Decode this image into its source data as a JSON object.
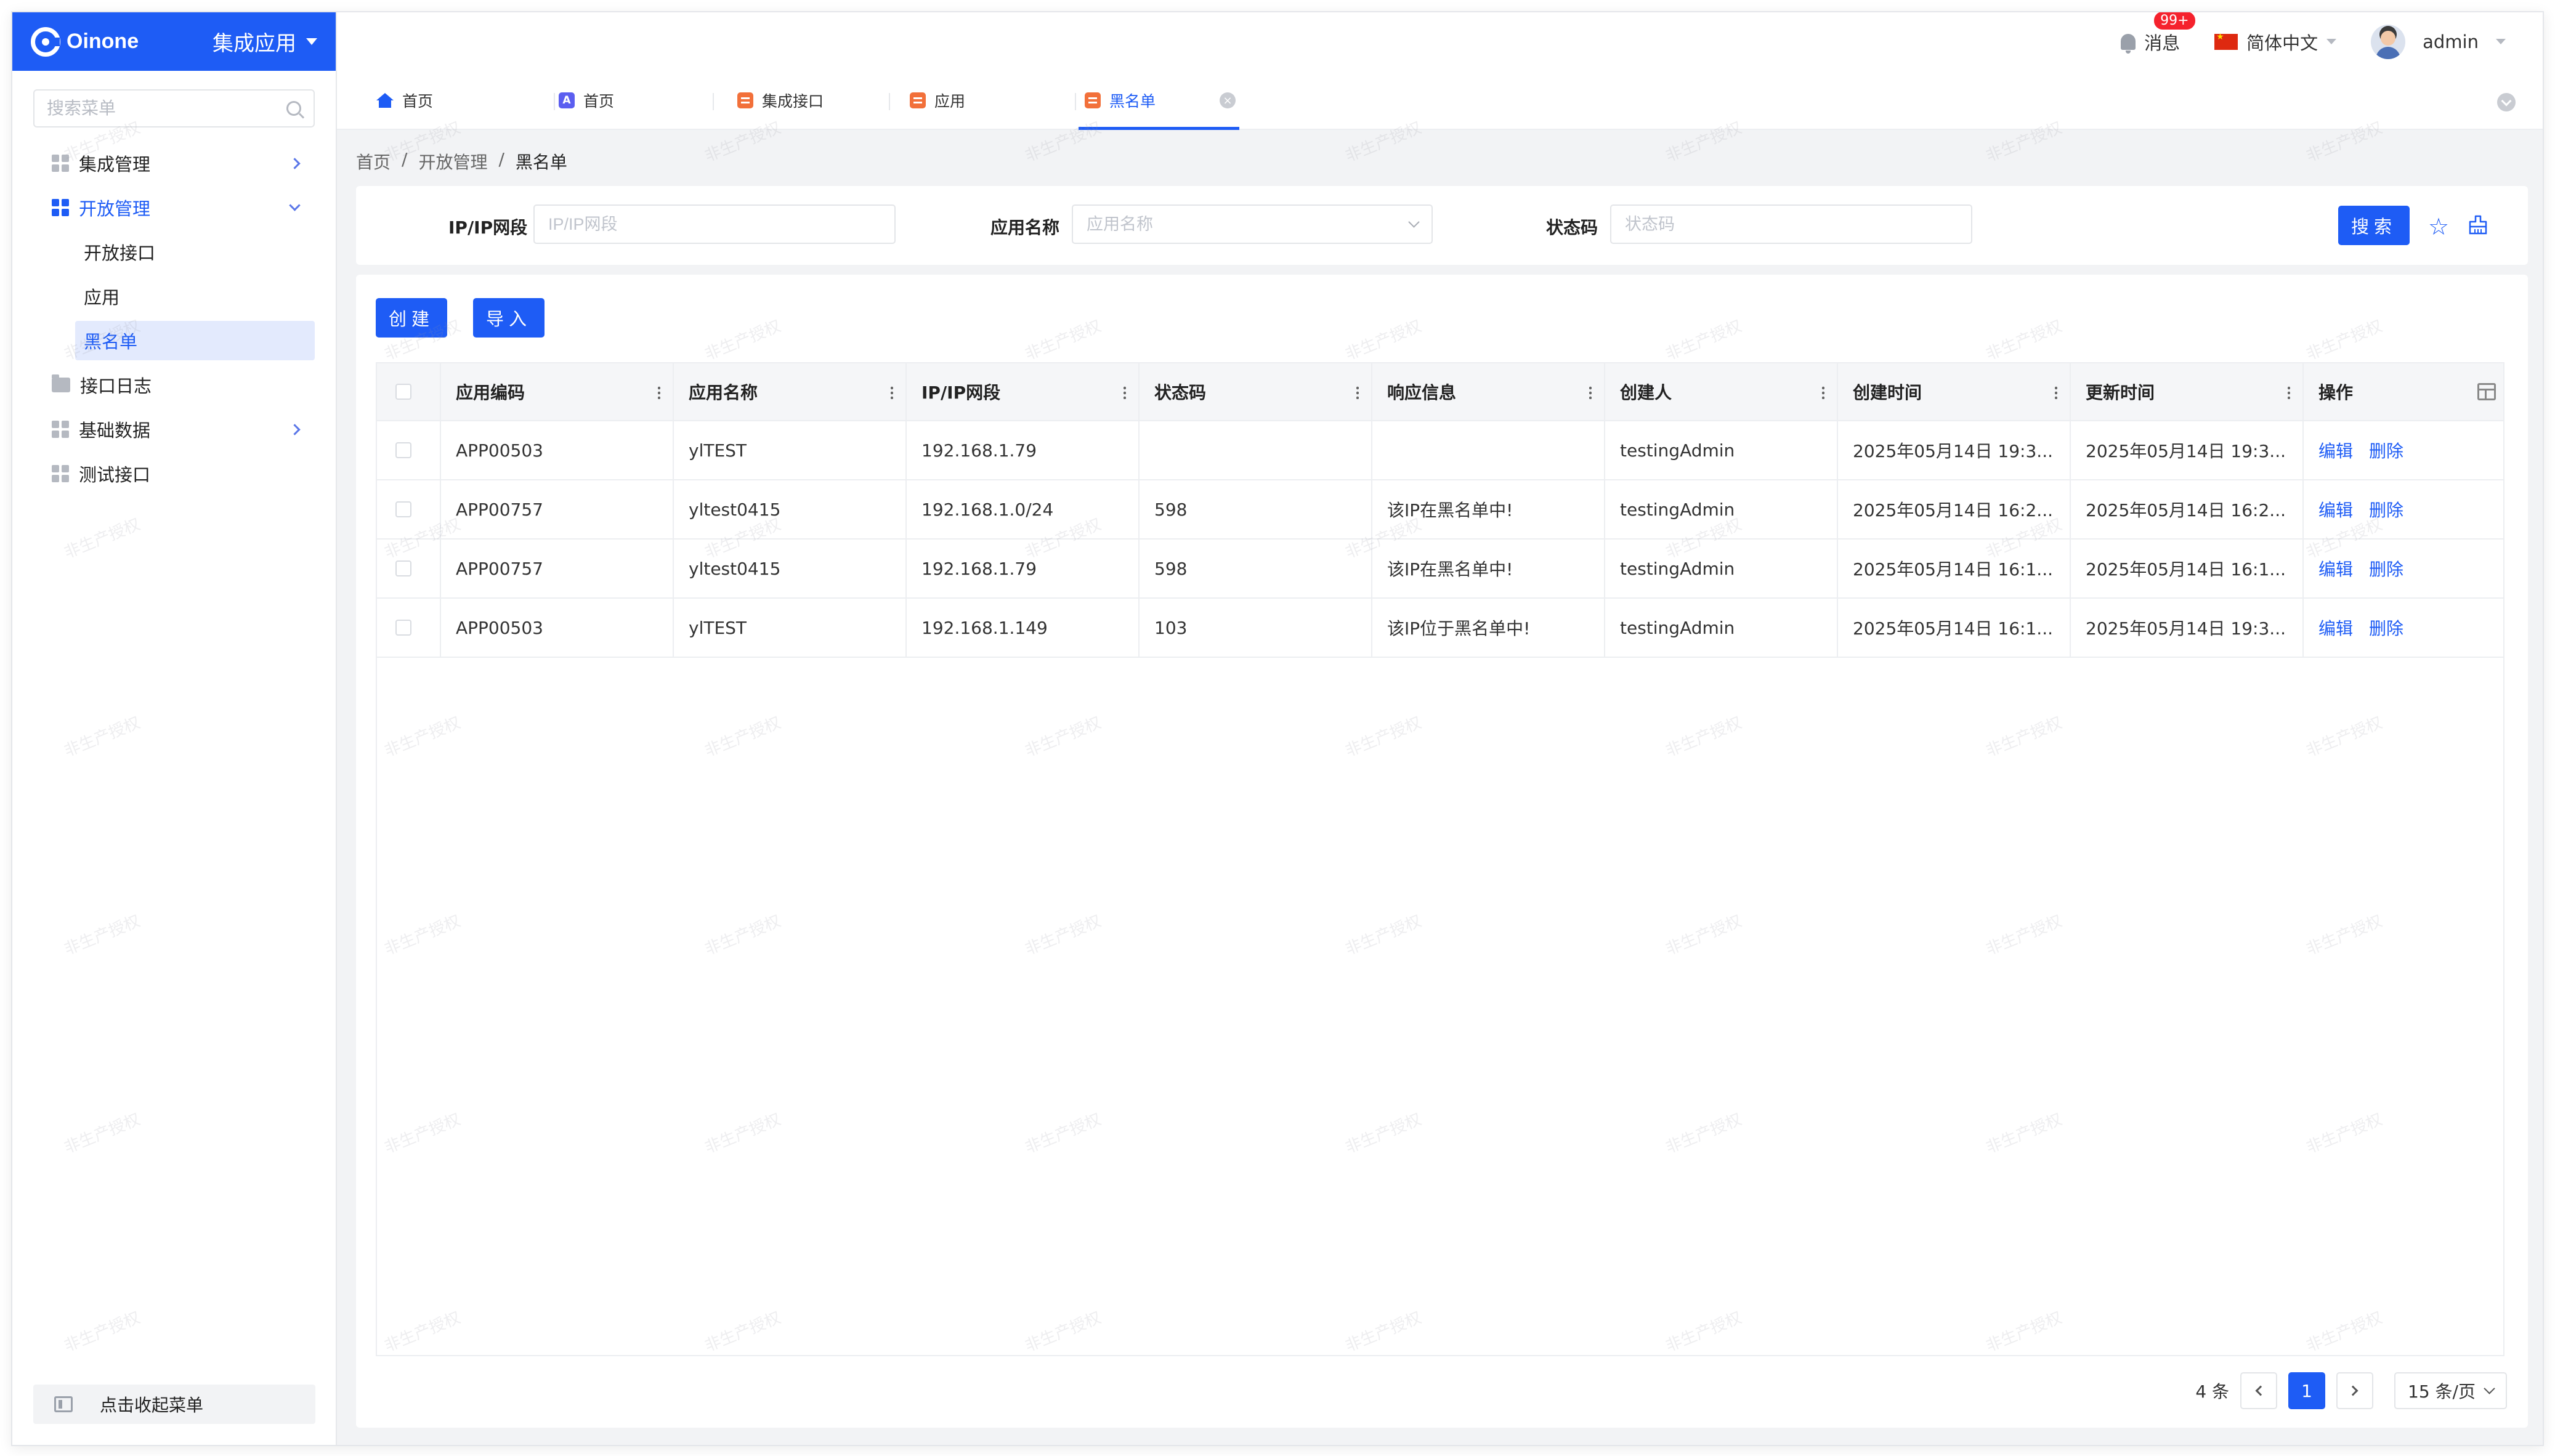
{
  "app": {
    "brand": "Oinone",
    "switcher_label": "集成应用"
  },
  "sidebar": {
    "search_placeholder": "搜索菜单",
    "menu": [
      {
        "label": "集成管理",
        "icon": "grid-icon",
        "expanded": false
      },
      {
        "label": "开放管理",
        "icon": "grid-icon",
        "expanded": true,
        "children": [
          "开放接口",
          "应用",
          "黑名单"
        ]
      },
      {
        "label": "接口日志",
        "icon": "folder-icon"
      },
      {
        "label": "基础数据",
        "icon": "grid-icon",
        "expanded": false
      },
      {
        "label": "测试接口",
        "icon": "grid-icon"
      }
    ],
    "selected": "黑名单",
    "collapse_label": "点击收起菜单"
  },
  "header": {
    "messages_label": "消息",
    "messages_badge": "99+",
    "language": "简体中文",
    "user": "admin"
  },
  "tabs": [
    {
      "label": "首页",
      "icon": "home-icon"
    },
    {
      "label": "首页",
      "icon": "app-a-icon"
    },
    {
      "label": "集成接口",
      "icon": "module-icon"
    },
    {
      "label": "应用",
      "icon": "module-icon"
    },
    {
      "label": "黑名单",
      "icon": "module-icon",
      "active": true
    }
  ],
  "breadcrumb": [
    "首页",
    "开放管理",
    "黑名单"
  ],
  "filters": {
    "ip_label": "IP/IP网段",
    "ip_placeholder": "IP/IP网段",
    "app_label": "应用名称",
    "app_placeholder": "应用名称",
    "status_label": "状态码",
    "status_placeholder": "状态码",
    "search_button": "搜索"
  },
  "actions": {
    "create": "创建",
    "import": "导入"
  },
  "table": {
    "columns": [
      "应用编码",
      "应用名称",
      "IP/IP网段",
      "状态码",
      "响应信息",
      "创建人",
      "创建时间",
      "更新时间",
      "操作"
    ],
    "rows": [
      [
        "APP00503",
        "ylTEST",
        "192.168.1.79",
        "",
        "",
        "testingAdmin",
        "2025年05月14日 19:3...",
        "2025年05月14日 19:3..."
      ],
      [
        "APP00757",
        "yltest0415",
        "192.168.1.0/24",
        "598",
        "该IP在黑名单中!",
        "testingAdmin",
        "2025年05月14日 16:2...",
        "2025年05月14日 16:2..."
      ],
      [
        "APP00757",
        "yltest0415",
        "192.168.1.79",
        "598",
        "该IP在黑名单中!",
        "testingAdmin",
        "2025年05月14日 16:1...",
        "2025年05月14日 16:1..."
      ],
      [
        "APP00503",
        "ylTEST",
        "192.168.1.149",
        "103",
        "该IP位于黑名单中!",
        "testingAdmin",
        "2025年05月14日 16:1...",
        "2025年05月14日 19:3..."
      ]
    ],
    "row_actions": [
      "编辑",
      "删除"
    ]
  },
  "pagination": {
    "total": "4 条",
    "current_page": "1",
    "page_size": "15 条/页"
  },
  "watermark": "非生产授权",
  "colors": {
    "primary": "#1e5cf5",
    "badge": "#f5222d",
    "module_icon": "#f2703a"
  }
}
